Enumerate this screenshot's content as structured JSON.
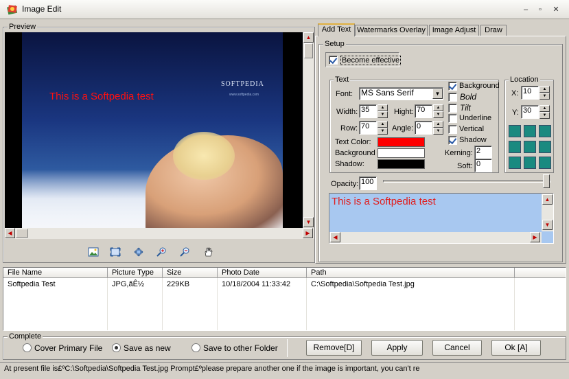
{
  "window": {
    "title": "Image Edit",
    "minimize": "–",
    "maximize": "▫",
    "close": "✕"
  },
  "preview": {
    "label": "Preview",
    "image_caption": "This is a Softpedia test",
    "logo_text": "SOFTPEDIA",
    "logo_sub": "www.softpedia.com",
    "toolbar_icons": [
      "picture-icon",
      "fit-icon",
      "actual-size-icon",
      "zoom-in-icon",
      "zoom-out-icon",
      "hand-icon"
    ]
  },
  "tabs": [
    {
      "label": "Add Text",
      "active": true
    },
    {
      "label": "Watermarks Overlay",
      "active": false
    },
    {
      "label": "Image Adjust",
      "active": false
    },
    {
      "label": "Draw",
      "active": false
    }
  ],
  "setup": {
    "label": "Setup",
    "become_effective": "Become effective",
    "text_group": "Text",
    "font_label": "Font:",
    "font_value": "MS Sans Serif",
    "width_label": "Width:",
    "width_value": "35",
    "hight_label": "Hight:",
    "hight_value": "70",
    "row_label": "Row:",
    "row_value": "70",
    "angle_label": "Angle:",
    "angle_value": "0",
    "text_color_label": "Text Color:",
    "background_label": "Background",
    "shadow_label": "Shadow:",
    "text_color": "#ff0000",
    "background_color": "#ffffff",
    "shadow_color": "#000000",
    "options": {
      "background": "Background",
      "bold": "Bold",
      "tilt": "Tilt",
      "underline": "Underline",
      "vertical": "Vertical",
      "shadow": "Shadow"
    },
    "kerning_label": "Kerning:",
    "kerning_value": "2",
    "soft_label": "Soft:",
    "soft_value": "0",
    "location_group": "Location",
    "x_label": "X:",
    "x_value": "10",
    "y_label": "Y:",
    "y_value": "30",
    "opacity_label": "Opacity:",
    "opacity_value": "100",
    "sample_text": "This is a Softpedia test"
  },
  "files": {
    "columns": [
      "File Name",
      "Picture Type",
      "Size",
      "Photo Date",
      "Path"
    ],
    "rows": [
      [
        "Softpedia Test",
        "JPG,ãÊ½",
        "229KB",
        "10/18/2004 11:33:42",
        "C:\\Softpedia\\Softpedia Test.jpg"
      ]
    ]
  },
  "complete": {
    "label": "Complete",
    "cover": "Cover Primary File",
    "save_new": "Save as new",
    "save_other": "Save to other Folder",
    "remove": "Remove[D]",
    "apply": "Apply",
    "cancel": "Cancel",
    "ok": "Ok [A]"
  },
  "status": "At present file is£ºC:\\Softpedia\\Softpedia Test.jpg  Prompt£ºplease prepare another one if the image is important, you can't re"
}
